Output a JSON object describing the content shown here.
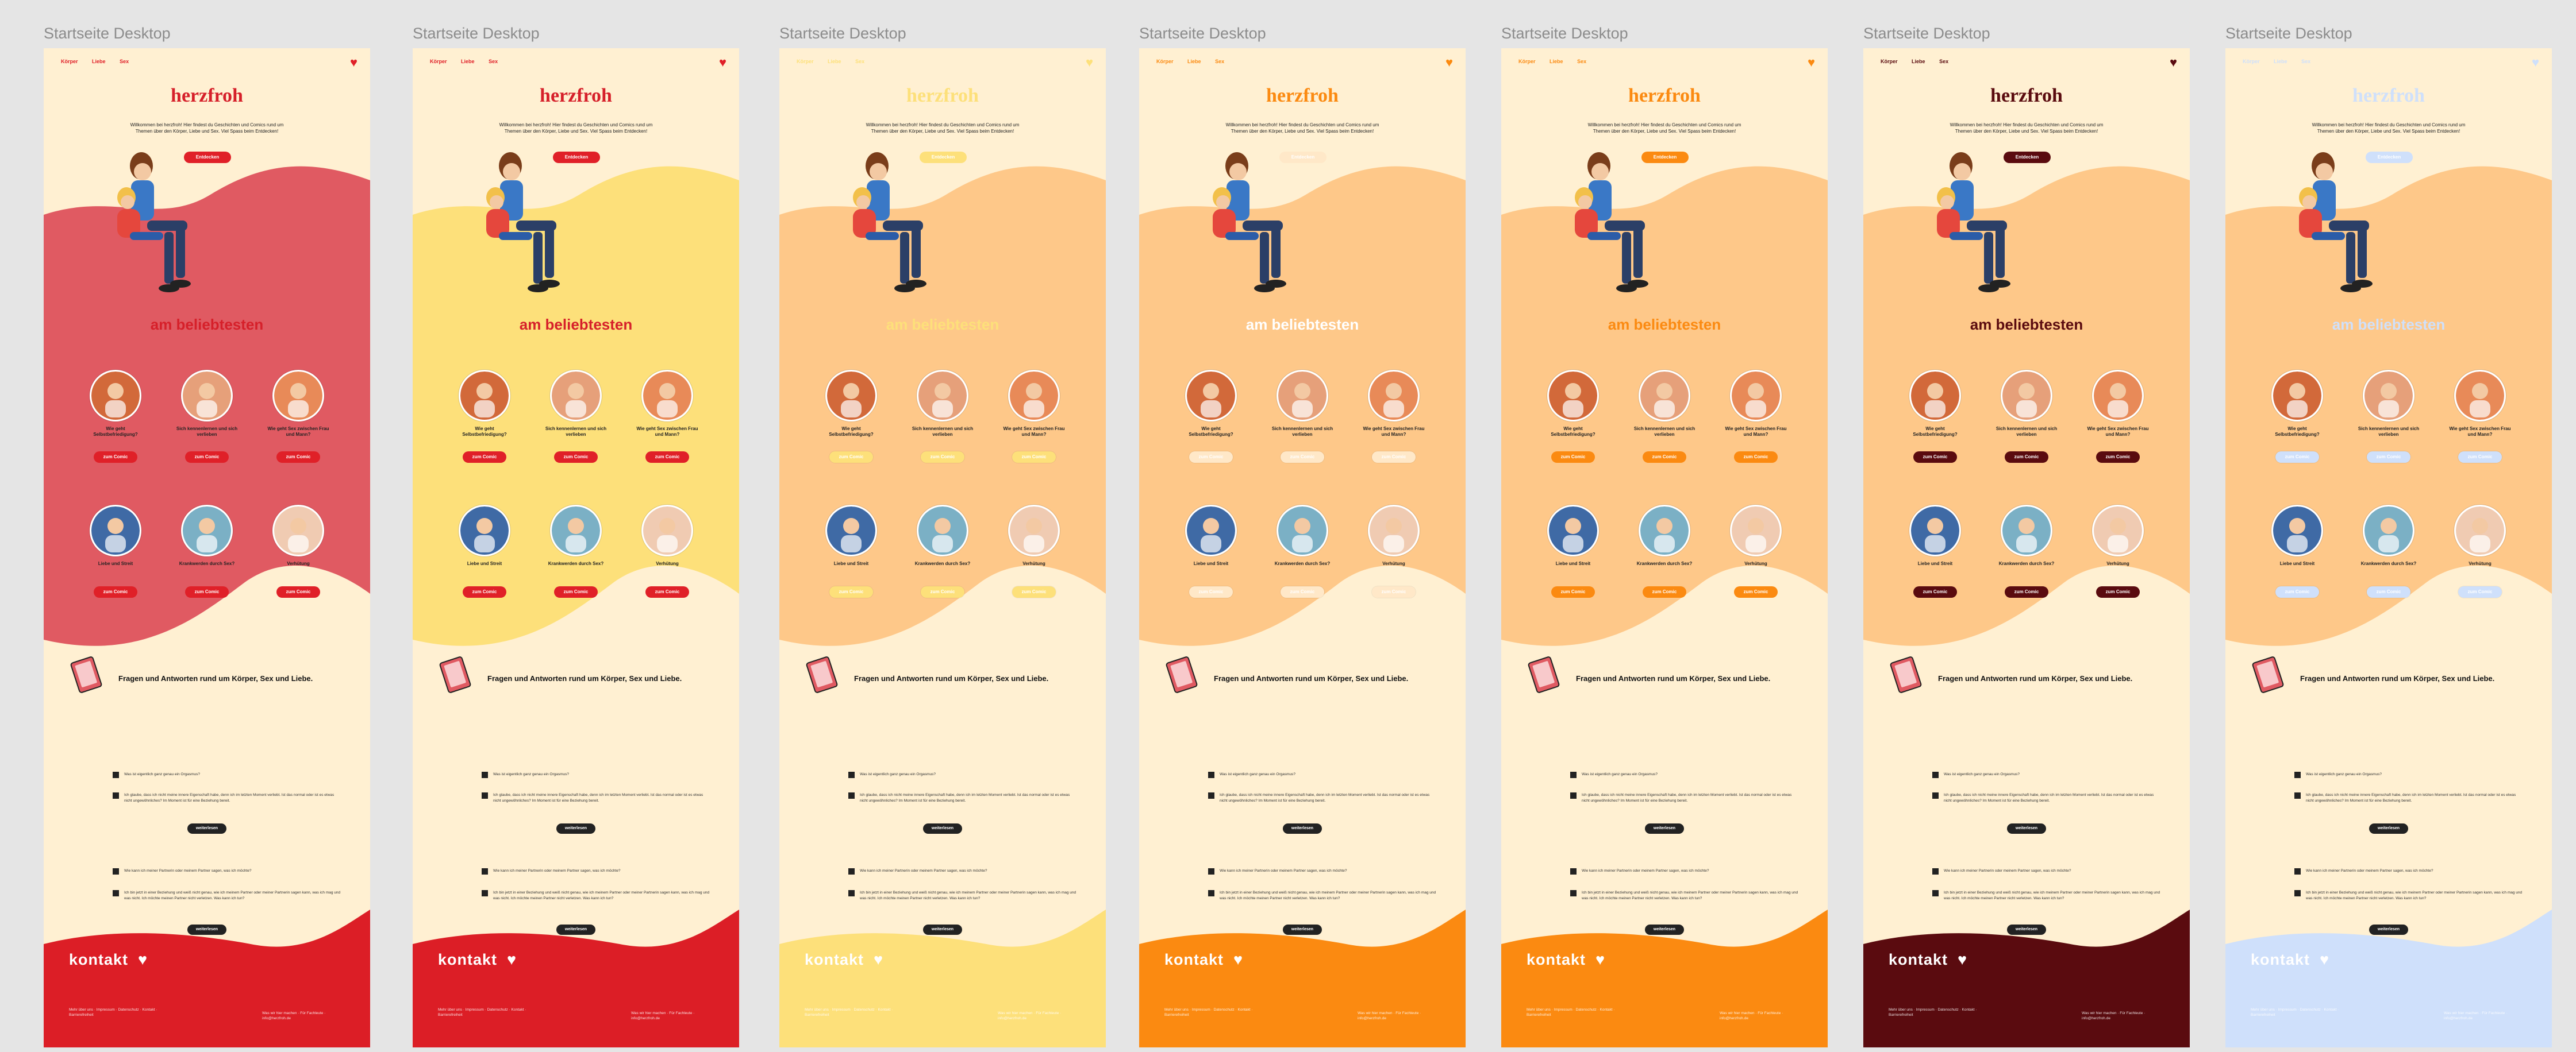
{
  "canvas": {
    "background": "#e5e5e5"
  },
  "frames": [
    {
      "label": "Startseite Desktop",
      "accent": "#e05a62",
      "top_accent": "#e02028",
      "footer": "#dc1e26",
      "btn": "#e02028",
      "logo_color": "#d6202a",
      "title_color": "#d6202a",
      "light": false
    },
    {
      "label": "Startseite Desktop",
      "accent": "#fde07a",
      "top_accent": "#e02028",
      "footer": "#dc1e26",
      "btn": "#e02028",
      "logo_color": "#d6202a",
      "title_color": "#d6202a",
      "light": false
    },
    {
      "label": "Startseite Desktop",
      "accent": "#fec889",
      "top_accent": "#fde07a",
      "footer": "#fde07a",
      "btn": "#fde07a",
      "logo_color": "#fde07a",
      "title_color": "#fde07a",
      "light": true
    },
    {
      "label": "Startseite Desktop",
      "accent": "#fec889",
      "top_accent": "#fb8a11",
      "footer": "#fb8a11",
      "btn": "#ffe8c8",
      "logo_color": "#fb8a11",
      "title_color": "#ffffff",
      "light": true
    },
    {
      "label": "Startseite Desktop",
      "accent": "#fec889",
      "top_accent": "#fb8a11",
      "footer": "#fb8a11",
      "btn": "#fb8a11",
      "logo_color": "#fb8a11",
      "title_color": "#fb8a11",
      "light": false
    },
    {
      "label": "Startseite Desktop",
      "accent": "#fec889",
      "top_accent": "#5a0b0f",
      "footer": "#5a0b0f",
      "btn": "#5a0b0f",
      "logo_color": "#5a0b0f",
      "title_color": "#5a0b0f",
      "light": false
    },
    {
      "label": "Startseite Desktop",
      "accent": "#fec889",
      "top_accent": "#cfe0fb",
      "footer": "#cfe0fb",
      "btn": "#cfe0fb",
      "logo_color": "#cfe0fb",
      "title_color": "#cfe0fb",
      "light": true
    }
  ],
  "nav": {
    "item1": "Körper",
    "item2": "Liebe",
    "item3": "Sex"
  },
  "logo": "herzfroh",
  "intro": "Willkommen bei herzfroh! Hier findest du Geschichten und Comics rund um Themen über den Körper, Liebe und Sex. Viel Spass beim Entdecken!",
  "cta": "Entdecken",
  "section_title": "am beliebtesten",
  "cards": [
    {
      "title": "Wie geht Selbstbefriedigung?",
      "btn": "zum Comic"
    },
    {
      "title": "Sich kennenlernen und sich verlieben",
      "btn": "zum Comic"
    },
    {
      "title": "Wie geht Sex zwischen Frau und Mann?",
      "btn": "zum Comic"
    },
    {
      "title": "Liebe und Streit",
      "btn": "zum Comic"
    },
    {
      "title": "Krankwerden durch Sex?",
      "btn": "zum Comic"
    },
    {
      "title": "Verhütung",
      "btn": "zum Comic"
    }
  ],
  "faq_heading": "Fragen und Antworten rund um Körper, Sex und Liebe.",
  "faq": [
    {
      "q": "Was ist eigentlich ganz genau ein Orgasmus?",
      "a": "Ich glaube, dass ich nicht meine innere Eigenschaft habe, denn ich im letzten Moment verliebt. Ist das normal oder ist es etwas nicht ungewöhnliches? Im Moment ist für eine Beziehung bereit.",
      "btn": "weiterlesen"
    },
    {
      "q": "Wie kann ich meiner Partnerin oder meinem Partner sagen, was ich möchte?",
      "a": "Ich bin jetzt in einer Beziehung und weiß nicht genau, wie ich meinem Partner oder meiner Partnerin sagen kann, was ich mag und was nicht. Ich möchte meinen Partner nicht verletzen. Was kann ich tun?",
      "btn": "weiterlesen"
    }
  ],
  "kontakt": "kontakt",
  "footer_left": "Mehr über uns · Impressum · Datenschutz · Kontakt · Barrierefreiheit",
  "footer_right": "Was wir hier machen · Für Fachleute · info@herzfroh.de"
}
